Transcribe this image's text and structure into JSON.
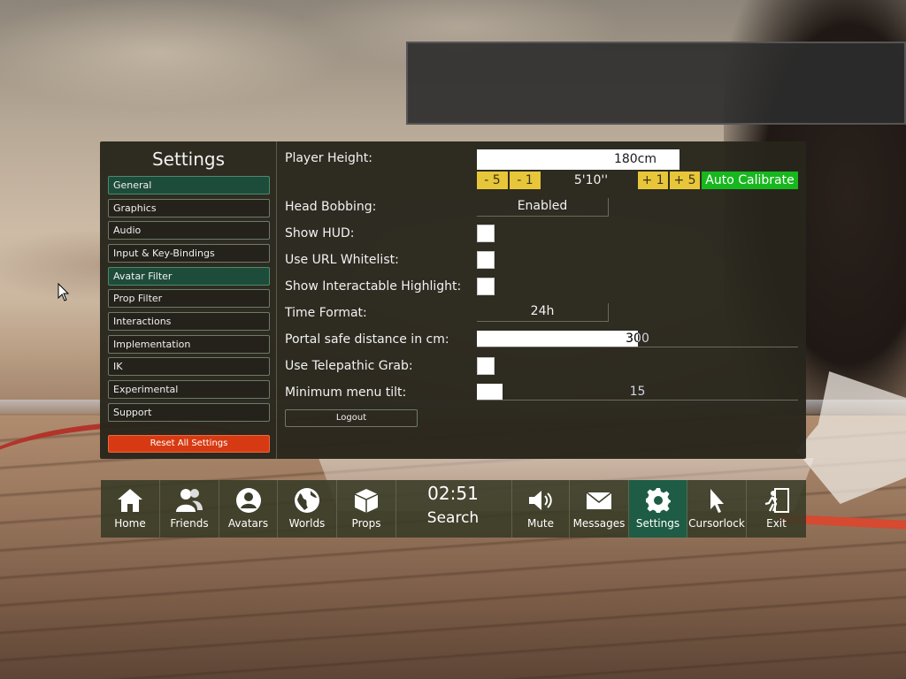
{
  "settings": {
    "title": "Settings",
    "categories": [
      {
        "label": "General",
        "active": true
      },
      {
        "label": "Graphics",
        "active": false
      },
      {
        "label": "Audio",
        "active": false
      },
      {
        "label": "Input & Key-Bindings",
        "active": false
      },
      {
        "label": "Avatar Filter",
        "active": true
      },
      {
        "label": "Prop Filter",
        "active": false
      },
      {
        "label": "Interactions",
        "active": false
      },
      {
        "label": "Implementation",
        "active": false
      },
      {
        "label": "IK",
        "active": false
      },
      {
        "label": "Experimental",
        "active": false
      },
      {
        "label": "Support",
        "active": false
      }
    ],
    "reset_label": "Reset All Settings",
    "player_height": {
      "label": "Player Height:",
      "value": "180cm",
      "imperial": "5'10''",
      "minus5": "- 5",
      "minus1": "- 1",
      "plus1": "+ 1",
      "plus5": "+ 5",
      "auto_calibrate": "Auto Calibrate"
    },
    "head_bobbing": {
      "label": "Head Bobbing:",
      "value": "Enabled"
    },
    "show_hud": {
      "label": "Show HUD:",
      "checked": false
    },
    "url_whitelist": {
      "label": "Use URL Whitelist:",
      "checked": false
    },
    "interactable_highlight": {
      "label": "Show Interactable Highlight:",
      "checked": false
    },
    "time_format": {
      "label": "Time Format:",
      "value": "24h"
    },
    "portal_safe_distance": {
      "label": "Portal safe distance in cm:",
      "value": "300",
      "level_percent": 50
    },
    "telepathic_grab": {
      "label": "Use Telepathic Grab:",
      "checked": false
    },
    "min_menu_tilt": {
      "label": "Minimum menu tilt:",
      "value": "15",
      "level_percent": 8
    },
    "logout_label": "Logout"
  },
  "menu": {
    "home": "Home",
    "friends": "Friends",
    "avatars": "Avatars",
    "worlds": "Worlds",
    "props": "Props",
    "clock": "02:51",
    "search": "Search",
    "mute": "Mute",
    "messages": "Messages",
    "settings": "Settings",
    "cursorlock": "Cursorlock",
    "exit": "Exit"
  },
  "colors": {
    "active_green": "#1e5c45",
    "reset_red": "#d73a12",
    "step_yellow": "#e7c63a",
    "calibrate_green": "#17b71e"
  }
}
